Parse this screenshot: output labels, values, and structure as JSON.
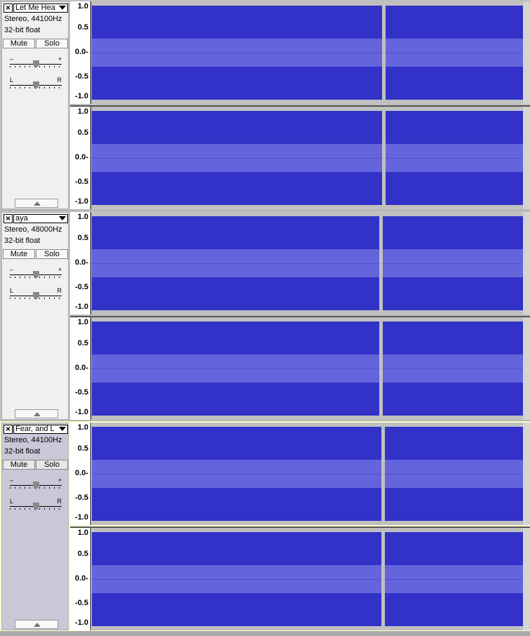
{
  "tracks": [
    {
      "name": "Let Me Hea",
      "rate": "Stereo, 44100Hz",
      "format": "32-bit float",
      "mute_label": "Mute",
      "solo_label": "Solo",
      "gain_minus": "–",
      "gain_plus": "+",
      "pan_left": "L",
      "pan_right": "R",
      "selected": false
    },
    {
      "name": "aya",
      "rate": "Stereo, 48000Hz",
      "format": "32-bit float",
      "mute_label": "Mute",
      "solo_label": "Solo",
      "gain_minus": "–",
      "gain_plus": "+",
      "pan_left": "L",
      "pan_right": "R",
      "selected": false
    },
    {
      "name": "Fear, and L",
      "rate": "Stereo, 44100Hz",
      "format": "32-bit float",
      "mute_label": "Mute",
      "solo_label": "Solo",
      "gain_minus": "–",
      "gain_plus": "+",
      "pan_left": "L",
      "pan_right": "R",
      "selected": true
    }
  ],
  "ruler_labels": [
    "1.0",
    "0.5",
    "0.0-",
    "-0.5",
    "-1.0"
  ],
  "colors": {
    "waveform_peak": "#3232c8",
    "waveform_rms": "#6464dc",
    "background": "#c0c0c0",
    "selected_track": "#ffffcc"
  }
}
